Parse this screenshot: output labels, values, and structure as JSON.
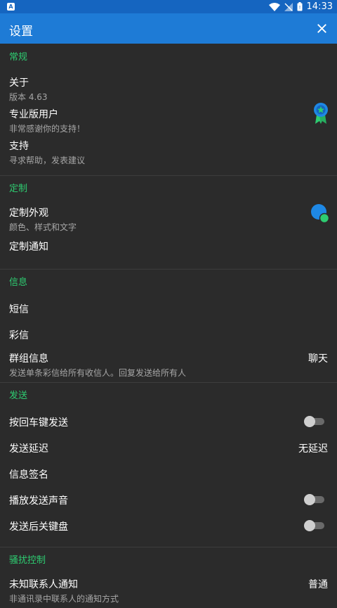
{
  "status_bar": {
    "badge": "A",
    "time": "14:33"
  },
  "app_bar": {
    "title": "设置"
  },
  "sections": {
    "general": {
      "header": "常规",
      "about": {
        "label": "关于",
        "sub": "版本 4.63"
      },
      "pro": {
        "label": "专业版用户",
        "sub": "非常感谢你的支持！"
      },
      "support": {
        "label": "支持",
        "sub": "寻求帮助，发表建议"
      }
    },
    "customize": {
      "header": "定制",
      "appearance": {
        "label": "定制外观",
        "sub": "颜色、样式和文字"
      },
      "notifications": {
        "label": "定制通知"
      }
    },
    "messages": {
      "header": "信息",
      "sms": {
        "label": "短信"
      },
      "mms": {
        "label": "彩信"
      },
      "group": {
        "label": "群组信息",
        "sub": "发送单条彩信给所有收信人。回复发送给所有人",
        "value": "聊天"
      }
    },
    "sending": {
      "header": "发送",
      "enter_send": {
        "label": "按回车键发送",
        "enabled": false
      },
      "delay": {
        "label": "发送延迟",
        "value": "无延迟"
      },
      "signature": {
        "label": "信息签名"
      },
      "sound": {
        "label": "播放发送声音",
        "enabled": false
      },
      "close_keyboard": {
        "label": "发送后关键盘",
        "enabled": false
      }
    },
    "harassment": {
      "header": "骚扰控制",
      "unknown": {
        "label": "未知联系人通知",
        "sub": "非通讯录中联系人的通知方式",
        "value": "普通"
      }
    }
  },
  "colors": {
    "status_bar": "#1565c0",
    "app_bar": "#1e7bd6",
    "accent": "#2ecc71",
    "background": "#2b2b2b"
  }
}
